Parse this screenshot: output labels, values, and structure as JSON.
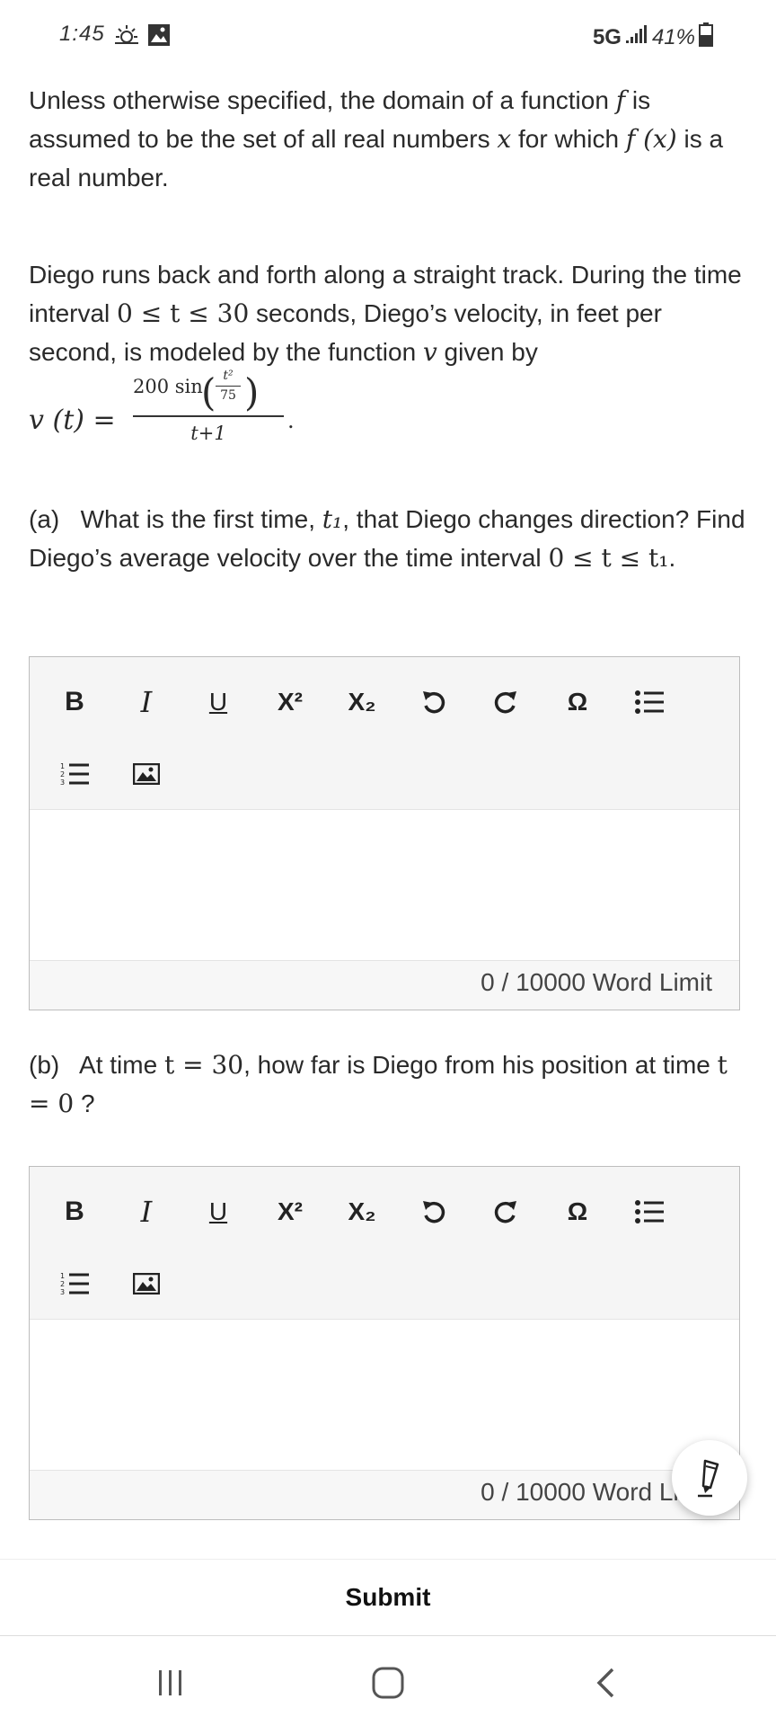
{
  "status_bar": {
    "time": "1:45",
    "network": "5G",
    "battery": "41%"
  },
  "intro": {
    "p1": "Unless otherwise specified, the domain of a function",
    "p1_f": "f",
    "p2": "is assumed to be the set of all real numbers",
    "p2_x": "x",
    "p3": "for which",
    "p3_fx": "f (x)",
    "p4": "is a real number."
  },
  "problem": {
    "s1": "Diego runs back and forth along a straight track. During the time interval",
    "s1_math": "0 ≤ t ≤ 30",
    "s2": "seconds, Diego’s velocity, in feet per second, is modeled by the function",
    "s2_v": "v",
    "s3": "given by",
    "formula_lhs": "v (t) =",
    "formula_num_coef": "200 sin",
    "formula_inner_num": "t²",
    "formula_inner_den": "75",
    "formula_den": "t+1",
    "formula_end": "."
  },
  "part_a": {
    "label": "(a)",
    "q1": "What is the first time,",
    "q1_t1": "t₁",
    "q2": ", that Diego changes direction? Find Diego’s average velocity over the time interval",
    "q2_math": "0 ≤ t ≤ t₁",
    "q2_end": "."
  },
  "part_b": {
    "label": "(b)",
    "q1": "At time",
    "q1_math": "t = 30",
    "q2": ", how far is Diego from his position at time",
    "q2_math": "t = 0",
    "q2_end": " ?"
  },
  "toolbar": {
    "bold": "B",
    "italic": "I",
    "underline": "U",
    "superscript": "X²",
    "subscript": "X₂",
    "special_char": "Ω"
  },
  "editor_a": {
    "count": "0 / 10000 Word Limit"
  },
  "editor_b": {
    "count": "0 / 10000 Word Limit"
  },
  "submit_label": "Submit"
}
